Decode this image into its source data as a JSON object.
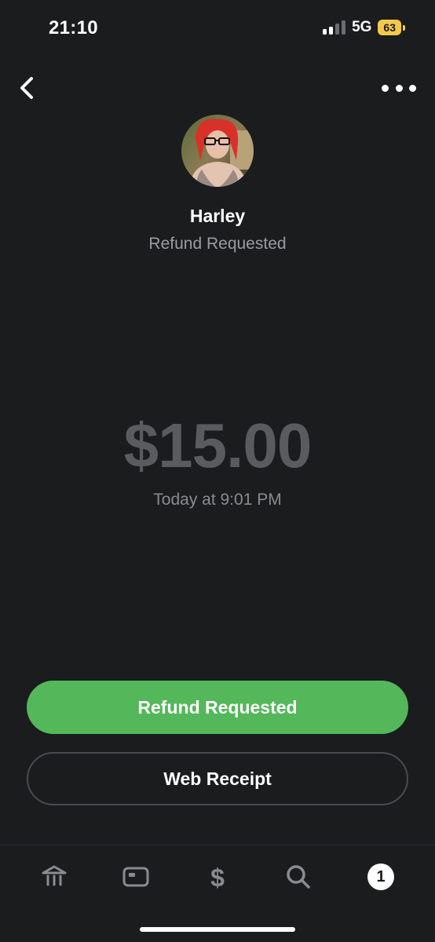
{
  "status_bar": {
    "time": "21:10",
    "network": "5G",
    "battery": "63"
  },
  "nav": {
    "back_icon": "chevron-left-icon",
    "more_icon": "more-horizontal-icon"
  },
  "profile": {
    "name": "Harley",
    "status": "Refund Requested"
  },
  "payment": {
    "amount": "$15.00",
    "timestamp": "Today at 9:01 PM"
  },
  "actions": {
    "primary_label": "Refund Requested",
    "secondary_label": "Web Receipt"
  },
  "tabbar": {
    "tabs": [
      {
        "icon": "bank-icon"
      },
      {
        "icon": "card-icon"
      },
      {
        "icon": "dollar-icon"
      },
      {
        "icon": "search-icon"
      },
      {
        "icon": "activity-icon",
        "badge": "1"
      }
    ]
  },
  "colors": {
    "background": "#1b1c1e",
    "accent_green": "#54b75a",
    "amount_gray": "#5a5b5e",
    "battery_yellow": "#f2c94c"
  }
}
